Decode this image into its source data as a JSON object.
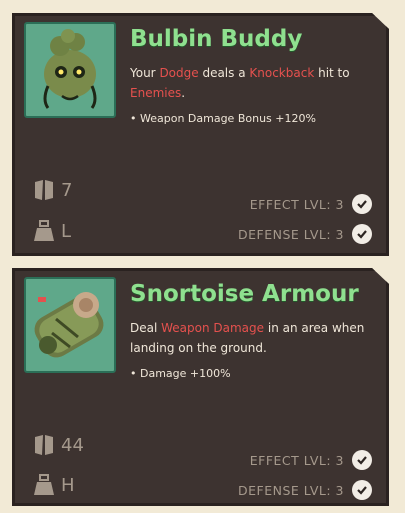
{
  "cards": [
    {
      "icon": "bulbin-buddy-icon",
      "title": "Bulbin Buddy",
      "desc": {
        "p1": "Your ",
        "h1": "Dodge",
        "p2": " deals a ",
        "h2": "Knockback",
        "p3": " hit to ",
        "h3": "Enemies",
        "p4": "."
      },
      "bullet": "• Weapon Damage Bonus +120%",
      "stats": {
        "weight": "7",
        "size": "L"
      },
      "effect_lvl": "EFFECT LVL: 3",
      "defense_lvl": "DEFENSE LVL: 3"
    },
    {
      "icon": "snortoise-armour-icon",
      "title": "Snortoise Armour",
      "desc": {
        "p1": "Deal ",
        "h1": "Weapon Damage",
        "p2": " in an area when landing on the ground."
      },
      "bullet": "• Damage +100%",
      "stats": {
        "weight": "44",
        "size": "H"
      },
      "effect_lvl": "EFFECT LVL: 3",
      "defense_lvl": "DEFENSE LVL: 3"
    }
  ],
  "colors": {
    "card_bg": "#3d3330",
    "title": "#8fe08f",
    "highlight": "#e5514e",
    "muted": "#a5998c",
    "background": "#f2ead6"
  }
}
